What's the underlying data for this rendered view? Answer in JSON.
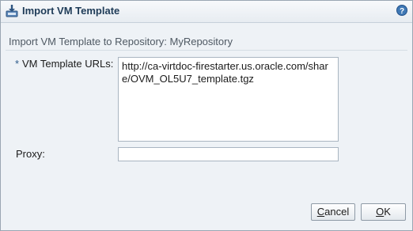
{
  "dialog": {
    "title": "Import VM Template",
    "subtitle": "Import VM Template to Repository: MyRepository"
  },
  "form": {
    "required_marker": "*",
    "urls_label": "VM Template URLs:",
    "urls_value": "http://ca-virtdoc-firestarter.us.oracle.com/share/OVM_OL5U7_template.tgz",
    "proxy_label": "Proxy:",
    "proxy_value": ""
  },
  "buttons": {
    "cancel_first": "C",
    "cancel_rest": "ancel",
    "ok_first": "O",
    "ok_rest": "K"
  },
  "icons": {
    "title": "import-download-icon",
    "help": "help-icon"
  },
  "colors": {
    "title_text": "#1e3b57",
    "accent": "#2c5a8a",
    "panel_bg": "#eef2f6"
  }
}
